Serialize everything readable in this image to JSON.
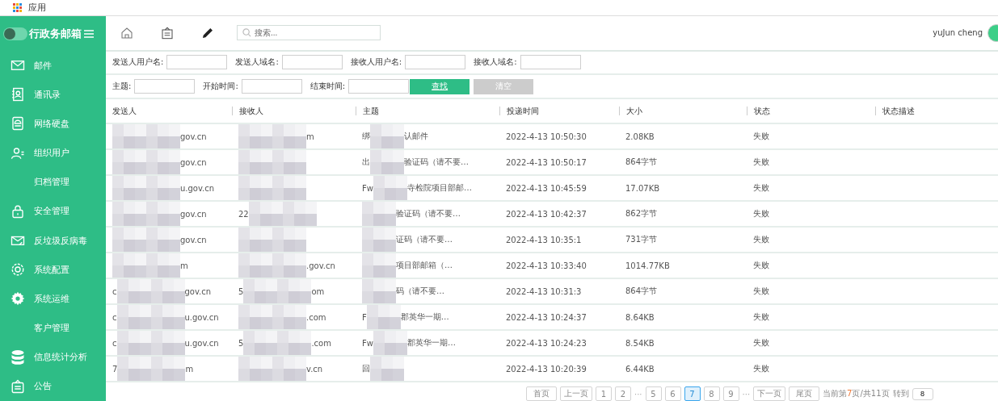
{
  "top_bar": {
    "title": "应用"
  },
  "sidebar": {
    "brand": "行政务邮箱",
    "items": [
      {
        "label": "邮件"
      },
      {
        "label": "通讯录"
      },
      {
        "label": "网络硬盘"
      },
      {
        "label": "组织用户"
      },
      {
        "label": "归档管理"
      },
      {
        "label": "安全管理"
      },
      {
        "label": "反垃圾反病毒"
      },
      {
        "label": "系统配置"
      },
      {
        "label": "系统运维"
      },
      {
        "label": "客户管理"
      },
      {
        "label": "信息统计分析"
      },
      {
        "label": "公告"
      }
    ]
  },
  "header": {
    "search": {
      "placeholder": "搜索..."
    },
    "user": "yuJun cheng"
  },
  "filters": [
    [
      {
        "label": "发送人用户名:"
      },
      {
        "label": "发送人域名:"
      },
      {
        "label": "接收人用户名:"
      },
      {
        "label": "接收人域名:"
      }
    ],
    [
      {
        "label": "主题:"
      },
      {
        "label": "开始时间:"
      },
      {
        "label": "结束时间:"
      }
    ]
  ],
  "buttons": [
    {
      "label": "查找",
      "kind": "primary"
    },
    {
      "label": "清空",
      "kind": "muted"
    }
  ],
  "table": {
    "columns": [
      "发送人",
      "接收人",
      "主题",
      "投递时间",
      "大小",
      "状态",
      "状态描述"
    ],
    "rows": [
      {
        "sender": {
          "post": "gov.cn"
        },
        "receiver": {
          "post": "m"
        },
        "subject": {
          "pre": "绑",
          "post": "认邮件"
        },
        "time": "2022-4-13 10:50:30",
        "size": "2.08KB",
        "status": "失败"
      },
      {
        "sender": {
          "post": "gov.cn"
        },
        "receiver": {},
        "subject": {
          "pre": "出",
          "post": "验证码（请不要…"
        },
        "time": "2022-4-13 10:50:17",
        "size": "864字节",
        "status": "失败"
      },
      {
        "sender": {
          "post": "u.gov.cn"
        },
        "receiver": {},
        "subject": {
          "pre": "Fw",
          "post": "寺检院项目部邮…"
        },
        "time": "2022-4-13 10:45:59",
        "size": "17.07KB",
        "status": "失败"
      },
      {
        "sender": {
          "post": "gov.cn"
        },
        "receiver": {
          "pre": "22"
        },
        "subject": {
          "post": "验证码（请不要…"
        },
        "time": "2022-4-13 10:42:37",
        "size": "862字节",
        "status": "失败"
      },
      {
        "sender": {
          "post": "gov.cn"
        },
        "receiver": {},
        "subject": {
          "post": "证码（请不要…"
        },
        "time": "2022-4-13 10:35:1",
        "size": "731字节",
        "status": "失败"
      },
      {
        "sender": {
          "post": "m"
        },
        "receiver": {
          "post": ".gov.cn"
        },
        "subject": {
          "post": "项目部邮箱（…"
        },
        "time": "2022-4-13 10:33:40",
        "size": "1014.77KB",
        "status": "失败"
      },
      {
        "sender": {
          "pre": "c",
          "post": "gov.cn"
        },
        "receiver": {
          "pre": "5",
          "post": "om"
        },
        "subject": {
          "post": "码（请不要…"
        },
        "time": "2022-4-13 10:31:3",
        "size": "864字节",
        "status": "失败"
      },
      {
        "sender": {
          "pre": "c",
          "post": "u.gov.cn"
        },
        "receiver": {
          "post": ".com"
        },
        "subject": {
          "pre": "F",
          "post": "郡英华一期…"
        },
        "time": "2022-4-13 10:24:37",
        "size": "8.64KB",
        "status": "失败"
      },
      {
        "sender": {
          "pre": "c",
          "post": "u.gov.cn"
        },
        "receiver": {
          "pre": "5",
          "post": ".com"
        },
        "subject": {
          "pre": "Fw",
          "post": "郡英华一期…"
        },
        "time": "2022-4-13 10:24:23",
        "size": "8.54KB",
        "status": "失败"
      },
      {
        "sender": {
          "pre": "7",
          "post": "m"
        },
        "receiver": {
          "post": "v.cn"
        },
        "subject": {
          "pre": "回"
        },
        "time": "2022-4-13 10:20:39",
        "size": "6.44KB",
        "status": "失败"
      }
    ]
  },
  "pagination": {
    "items": [
      {
        "label": "首页",
        "kind": "button",
        "selected": false
      },
      {
        "label": "上一页",
        "kind": "button",
        "selected": false
      },
      {
        "label": "1",
        "kind": "button",
        "selected": false
      },
      {
        "label": "2",
        "kind": "button",
        "selected": false
      },
      {
        "label": "···",
        "kind": "gap"
      },
      {
        "label": "5",
        "kind": "button",
        "selected": false
      },
      {
        "label": "6",
        "kind": "button",
        "selected": false
      },
      {
        "label": "7",
        "kind": "button",
        "selected": true
      },
      {
        "label": "8",
        "kind": "button",
        "selected": false
      },
      {
        "label": "9",
        "kind": "button",
        "selected": false
      },
      {
        "label": "···",
        "kind": "gap"
      },
      {
        "label": "下一页",
        "kind": "button",
        "selected": false
      },
      {
        "label": "尾页",
        "kind": "button",
        "selected": false
      }
    ],
    "info": {
      "before": "当前第",
      "current": "7",
      "after": "页/共11页"
    },
    "goto_label": "转到",
    "goto_value": "8"
  }
}
